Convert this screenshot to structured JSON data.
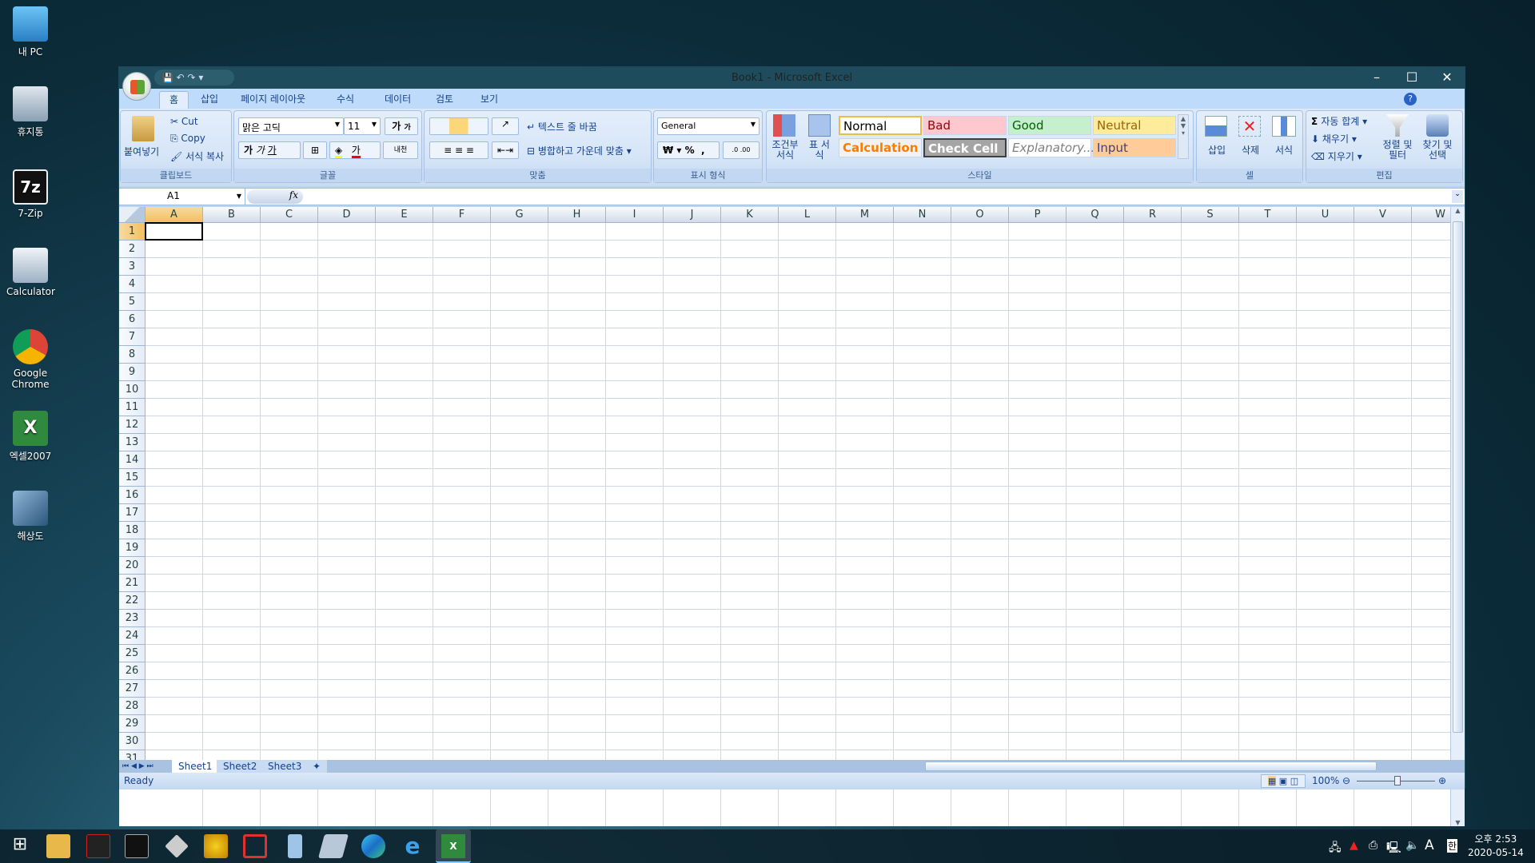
{
  "desktop": {
    "icons": [
      "내 PC",
      "휴지통",
      "7-Zip",
      "Calculator",
      "Google Chrome",
      "엑셀2007",
      "해상도"
    ]
  },
  "window": {
    "title": "Book1 - Microsoft Excel",
    "minimize": "–",
    "maximize": "☐",
    "close": "✕"
  },
  "qat": {
    "save": "💾",
    "undo": "↶",
    "redo": "↷",
    "more": "▾"
  },
  "tabs": [
    "홈",
    "삽입",
    "페이지 레이아웃",
    "수식",
    "데이터",
    "검토",
    "보기"
  ],
  "ribbon": {
    "clipboard": {
      "label": "클립보드",
      "paste": "붙여넣기",
      "cut": "Cut",
      "copy": "Copy",
      "format_painter": "서식 복사"
    },
    "font": {
      "label": "글꼴",
      "font_name": "맑은 고딕",
      "font_size": "11",
      "bold": "가",
      "italic": "가",
      "underline": "가",
      "grow": "가",
      "shrink": "가",
      "phonetic": "내천"
    },
    "alignment": {
      "label": "맞춤",
      "wrap": "텍스트 줄 바꿈",
      "merge": "병합하고 가운데 맞춤"
    },
    "number": {
      "label": "표시 형식",
      "format": "General",
      "currency": "₩",
      "percent": "%",
      "comma": ","
    },
    "styles": {
      "label": "스타일",
      "conditional": "조건부 서식",
      "table": "표 서식",
      "cells": [
        {
          "name": "Normal",
          "color": "#000000",
          "bg": "#ffffff"
        },
        {
          "name": "Bad",
          "color": "#9c0006",
          "bg": "#ffc7ce"
        },
        {
          "name": "Good",
          "color": "#006100",
          "bg": "#c6efce"
        },
        {
          "name": "Neutral",
          "color": "#9c6500",
          "bg": "#ffeb9c"
        },
        {
          "name": "Calculation",
          "color": "#fa7d00",
          "bg": "#f2f2f2"
        },
        {
          "name": "Check Cell",
          "color": "#ffffff",
          "bg": "#a5a5a5"
        },
        {
          "name": "Explanatory...",
          "color": "#7f7f7f",
          "bg": "#ffffff"
        },
        {
          "name": "Input",
          "color": "#3f3f76",
          "bg": "#ffcc99"
        }
      ]
    },
    "cells": {
      "label": "셀",
      "insert": "삽입",
      "delete": "삭제",
      "format": "서식"
    },
    "editing": {
      "label": "편집",
      "autosum": "자동 합계",
      "fill": "채우기",
      "clear": "지우기",
      "sort": "정렬 및 필터",
      "find": "찾기 및 선택"
    }
  },
  "formula_bar": {
    "name_box": "A1",
    "fx": "fx",
    "value": ""
  },
  "grid": {
    "columns": [
      "A",
      "B",
      "C",
      "D",
      "E",
      "F",
      "G",
      "H",
      "I",
      "J",
      "K",
      "L",
      "M",
      "N",
      "O",
      "P",
      "Q",
      "R",
      "S",
      "T",
      "U",
      "V",
      "W"
    ],
    "rows": 31,
    "active_cell": "A1"
  },
  "sheets": [
    "Sheet1",
    "Sheet2",
    "Sheet3"
  ],
  "status": {
    "text": "Ready",
    "zoom": "100%"
  },
  "tray": {
    "ime": "A",
    "lang": "한",
    "time": "오후 2:53",
    "date": "2020-05-14"
  }
}
